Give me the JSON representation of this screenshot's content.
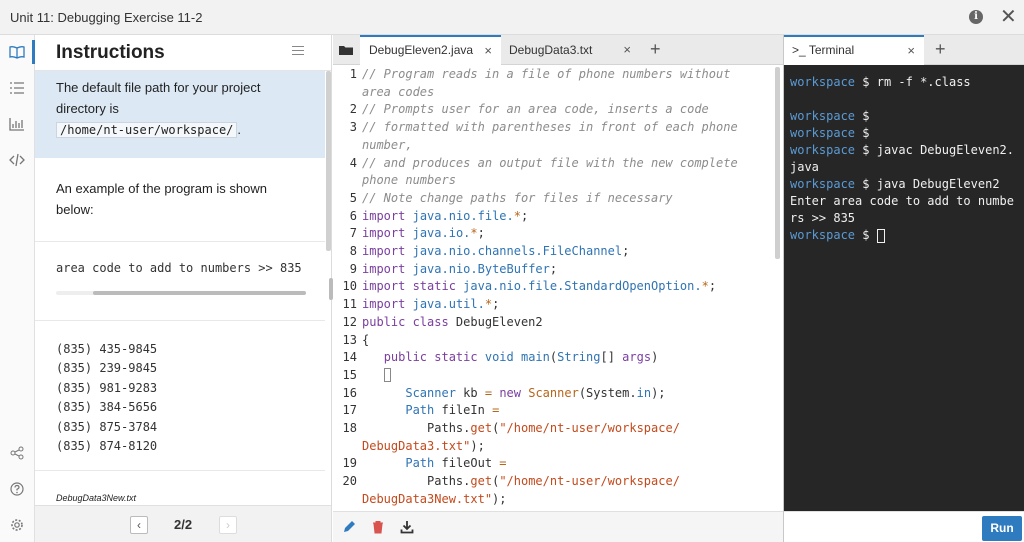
{
  "window": {
    "title": "Unit 11: Debugging Exercise 11-2",
    "info_icon": "i",
    "close_icon": "✕"
  },
  "rail": {
    "icons": [
      "book-icon",
      "checklist-icon",
      "chart-icon",
      "code-icon",
      "share-icon",
      "help-icon",
      "settings-icon"
    ]
  },
  "instructions": {
    "heading": "Instructions",
    "path_text": "The default file path for your project directory is",
    "path_value": "/home/nt-user/workspace/",
    "path_suffix": ".",
    "example_text": "An example of the program is shown below:",
    "prompt_line": "area code to add to numbers >> 835",
    "phones": [
      "(835) 435-9845",
      "(835) 239-9845",
      "(835) 981-9283",
      "(835) 384-5656",
      "(835) 875-3784",
      "(835) 874-8120"
    ],
    "file_label": "DebugData3New.txt",
    "pager": {
      "prev": "‹",
      "next": "›",
      "count": "2/2"
    }
  },
  "editor": {
    "tabs": [
      {
        "label": "DebugEleven2.java",
        "close": "×"
      },
      {
        "label": "DebugData3.txt",
        "close": "×"
      }
    ],
    "add_tab": "+",
    "line_numbers": [
      "1",
      "",
      "2",
      "3",
      "",
      "4",
      "",
      "5",
      "6",
      "7",
      "8",
      "9",
      "10",
      "11",
      "12",
      "13",
      "14",
      "15",
      "16",
      "17",
      "18",
      "",
      "19",
      "20",
      ""
    ]
  },
  "terminal": {
    "tab_label": "Terminal",
    "tab_prefix": ">_",
    "close": "×",
    "add_tab": "+",
    "prompt_user": "workspace",
    "prompt_sign": "$",
    "lines": [
      {
        "prompt": true,
        "text": "rm -f *.class"
      },
      {
        "prompt": false,
        "text": ""
      },
      {
        "prompt": true,
        "text": ""
      },
      {
        "prompt": true,
        "text": ""
      },
      {
        "prompt": true,
        "text": "javac DebugEleven2.java"
      },
      {
        "prompt": true,
        "text": "java DebugEleven2"
      },
      {
        "prompt": false,
        "text": "Enter area code to add to numbers >> 835"
      },
      {
        "prompt": true,
        "text": ""
      }
    ],
    "run_label": "Run"
  },
  "colors": {
    "accent": "#2f7bbf",
    "terminal_bg": "#262626",
    "prompt": "#5b9bd5",
    "note_bg": "#dce9f5",
    "delete": "#d9534f"
  }
}
